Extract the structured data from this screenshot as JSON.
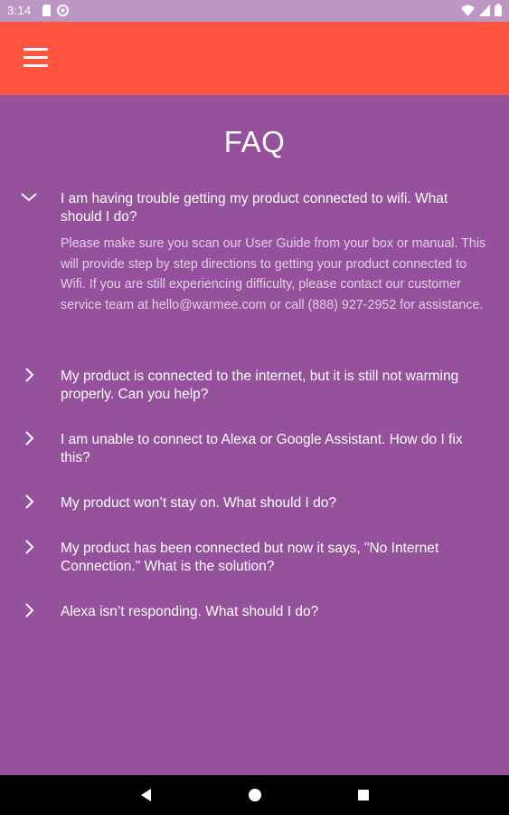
{
  "status_bar": {
    "time": "3:14",
    "icons": [
      "sd-card-icon",
      "circle-a-icon",
      "wifi-icon",
      "signal-icon",
      "battery-icon"
    ]
  },
  "app_bar": {
    "color": "#fe5440",
    "menu_icon": "hamburger-menu-icon"
  },
  "page": {
    "title": "FAQ",
    "background": "#95519b"
  },
  "faq": [
    {
      "question": "I am having trouble getting my product connected to wifi.  What should I do?",
      "expanded": true,
      "answer": "Please make sure you scan our User Guide from your box or manual. This will provide step by step directions to getting your product connected to Wifi.  If you are still experiencing difficulty, please contact our customer service team at hello@warmee.com or call (888) 927-2952 for assistance."
    },
    {
      "question": "My product is connected to the internet, but it is still not warming properly. Can you help?",
      "expanded": false
    },
    {
      "question": "I am unable to connect to Alexa or Google Assistant. How do I fix this?",
      "expanded": false
    },
    {
      "question": "My product won’t stay on. What should I do?",
      "expanded": false
    },
    {
      "question": "My product has been connected but now it says, \"No Internet Connection.\" What is the solution?",
      "expanded": false
    },
    {
      "question": "Alexa isn’t responding. What should I do?",
      "expanded": false
    }
  ],
  "nav_bar": {
    "buttons": [
      "back-triangle-icon",
      "home-circle-icon",
      "recents-square-icon"
    ]
  }
}
